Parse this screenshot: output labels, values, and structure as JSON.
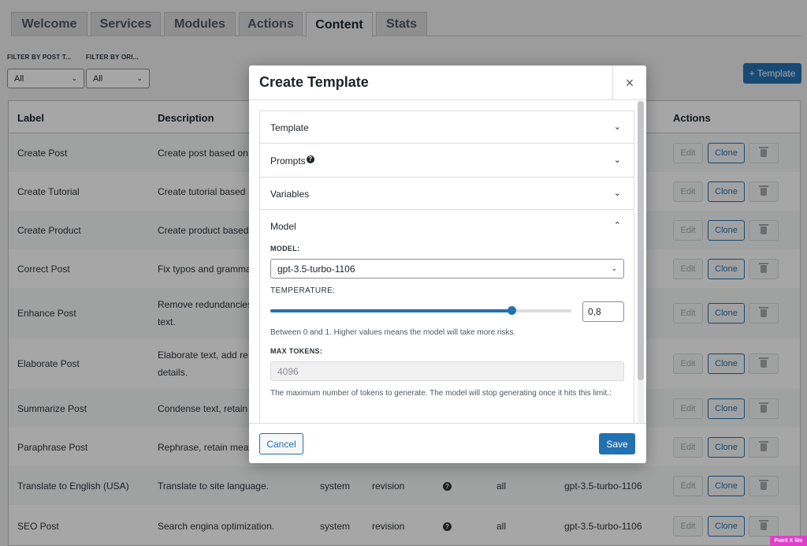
{
  "tabs": [
    "Welcome",
    "Services",
    "Modules",
    "Actions",
    "Content",
    "Stats"
  ],
  "filters": {
    "post_type_label": "FILTER BY POST T...",
    "origin_label": "FILTER BY ORI...",
    "post_type_value": "All",
    "origin_value": "All"
  },
  "template_button": "+ Template",
  "table": {
    "headers": {
      "label": "Label",
      "description": "Description",
      "actions": "Actions"
    },
    "action_labels": {
      "edit": "Edit",
      "clone": "Clone"
    },
    "rows": [
      {
        "label": "Create Post",
        "desc1": "Create post based on",
        "desc2": "",
        "c1": "",
        "c2": "",
        "c4": "",
        "c5": "",
        "q": false
      },
      {
        "label": "Create Tutorial",
        "desc1": "Create tutorial based",
        "desc2": "",
        "c1": "",
        "c2": "",
        "c4": "",
        "c5": "",
        "q": false
      },
      {
        "label": "Create Product",
        "desc1": "Create product based",
        "desc2": "",
        "c1": "",
        "c2": "",
        "c4": "",
        "c5": "",
        "q": false
      },
      {
        "label": "Correct Post",
        "desc1": "Fix typos and gramma",
        "desc2": "",
        "c1": "",
        "c2": "",
        "c4": "",
        "c5": "",
        "q": false
      },
      {
        "label": "Enhance Post",
        "desc1": "Remove redundancies",
        "desc2": "text.",
        "c1": "",
        "c2": "",
        "c4": "",
        "c5": "",
        "q": false
      },
      {
        "label": "Elaborate Post",
        "desc1": "Elaborate text, add re",
        "desc2": "details.",
        "c1": "",
        "c2": "",
        "c4": "",
        "c5": "",
        "q": false
      },
      {
        "label": "Summarize Post",
        "desc1": "Condense text, retain",
        "desc2": "",
        "c1": "",
        "c2": "",
        "c4": "",
        "c5": "",
        "q": false
      },
      {
        "label": "Paraphrase Post",
        "desc1": "Rephrase, retain mea",
        "desc2": "",
        "c1": "",
        "c2": "",
        "c4": "",
        "c5": "",
        "q": false
      },
      {
        "label": "Translate to English (USA)",
        "desc1": "Translate to site language.",
        "desc2": "",
        "c1": "system",
        "c2": "revision",
        "c4": "all",
        "c5": "gpt-3.5-turbo-1106",
        "q": true
      },
      {
        "label": "SEO Post",
        "desc1": "Search engina optimization.",
        "desc2": "",
        "c1": "system",
        "c2": "revision",
        "c4": "all",
        "c5": "gpt-3.5-turbo-1106",
        "q": true
      }
    ]
  },
  "modal": {
    "title": "Create Template",
    "close": "×",
    "sections": {
      "template": "Template",
      "prompts": "Prompts",
      "variables": "Variables",
      "model": "Model"
    },
    "model_label": "MODEL:",
    "model_value": "gpt-3.5-turbo-1106",
    "temperature_label": "TEMPERATURE:",
    "temperature_value": "0,8",
    "temperature_fraction": 0.8,
    "temperature_help": "Between 0 and 1. Higher values means the model will take more risks.",
    "max_tokens_label": "MAX TOKENS:",
    "max_tokens_value": "4096",
    "max_tokens_help": "The maximum number of tokens to generate. The model will stop generating once it hits this limit.:",
    "cancel": "Cancel",
    "save": "Save"
  },
  "watermark": "Paint X lite",
  "colors": {
    "accent": "#2271b1",
    "overlay": "rgba(0,0,0,0.35)"
  }
}
